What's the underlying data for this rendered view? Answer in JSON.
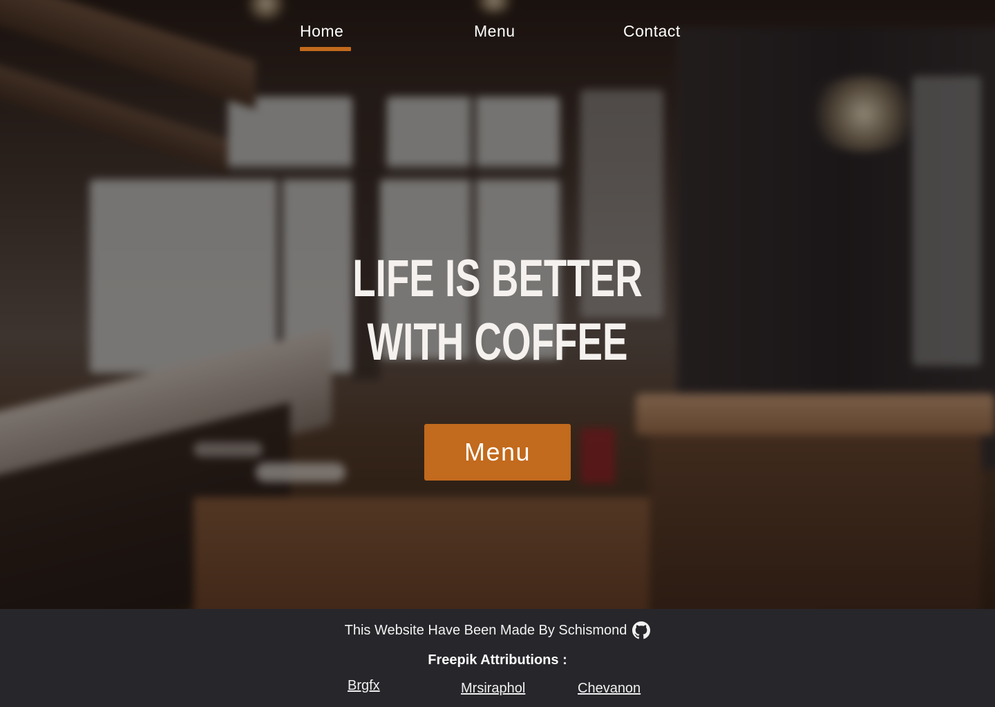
{
  "nav": {
    "items": [
      {
        "label": "Home",
        "active": true
      },
      {
        "label": "Menu",
        "active": false
      },
      {
        "label": "Contact",
        "active": false
      }
    ]
  },
  "hero": {
    "headline_line1": "LIFE IS BETTER",
    "headline_line2": "WITH COFFEE",
    "cta_label": "Menu"
  },
  "footer": {
    "credit": "This Website Have Been Made By Schismond",
    "credit_icon": "github-icon",
    "attributions_title": "Freepik Attributions :",
    "attributions": [
      "Brgfx",
      "Mrsiraphol",
      "Chevanon"
    ]
  },
  "colors": {
    "accent": "#c26a1d",
    "footer_bg": "#26262b",
    "text": "#ffffff"
  }
}
